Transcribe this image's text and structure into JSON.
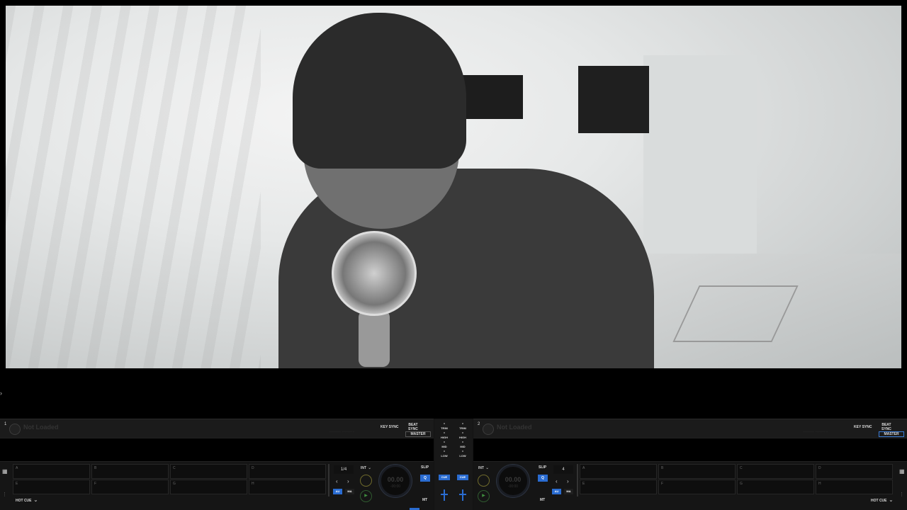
{
  "deck_left": {
    "number": "1",
    "title": "Not Loaded",
    "info": "-------- ------- -",
    "key_sync": "KEY SYNC",
    "beat_sync_line1": "BEAT",
    "beat_sync_line2": "SYNC",
    "master": "MASTER",
    "pads": [
      "A",
      "B",
      "C",
      "D",
      "E",
      "F",
      "G",
      "H"
    ],
    "hot_cue": "HOT CUE",
    "loop_size": "1/4",
    "int": "INT",
    "au": "AU",
    "ma": "MA",
    "time": "00.00",
    "remain": "-00:00",
    "slip": "SLIP",
    "q": "Q",
    "mt": "MT"
  },
  "deck_right": {
    "number": "2",
    "title": "Not Loaded",
    "info": "-------- ------- -",
    "key_sync": "KEY SYNC",
    "beat_sync_line1": "BEAT",
    "beat_sync_line2": "SYNC",
    "master": "MASTER",
    "pads": [
      "A",
      "B",
      "C",
      "D",
      "E",
      "F",
      "G",
      "H"
    ],
    "hot_cue": "HOT CUE",
    "loop_size": "4",
    "int": "INT",
    "au": "AU",
    "ma": "MA",
    "time": "00.00",
    "remain": "-00:00",
    "slip": "SLIP",
    "q": "Q",
    "mt": "MT"
  },
  "mixer": {
    "trim": "TRIM",
    "high": "HIGH",
    "mid": "MID",
    "low": "LOW",
    "cue": "CUE"
  },
  "icons": {
    "expander": "›",
    "grid": "▦",
    "dropdown": "⌄",
    "prev": "‹",
    "next": "›",
    "play": "▶"
  },
  "colors": {
    "accent": "#2a6cd1",
    "panel_bg": "#141414",
    "cue_ring": "#6f6a2c",
    "play_ring": "#2f5a2f"
  }
}
